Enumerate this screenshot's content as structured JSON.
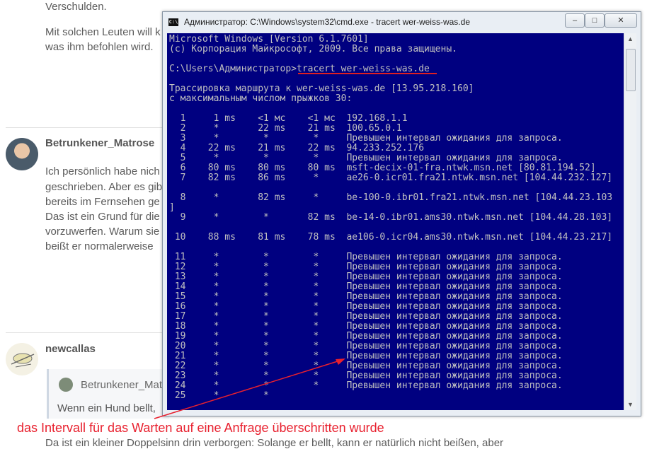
{
  "forum": {
    "p_top": "Verschulden.",
    "p2_line1": "Mit solchen Leuten will k",
    "p2_line2": "was ihm befohlen wird.",
    "user1": "Betrunkener_Matrose",
    "post1": [
      "Ich persönlich habe nich",
      "geschrieben. Aber es gib",
      "bereits im Fernsehen ge",
      "Das ist ein Grund für die",
      "vorzuwerfen. Warum sie",
      "beißt er normalerweise"
    ],
    "user2": "newcallas",
    "quote_user": "Betrunkener_Mat",
    "quote_text": "Wenn ein Hund bellt,",
    "bottom_text": "Da ist ein kleiner Doppelsinn drin verborgen: Solange er bellt, kann er natürlich nicht beißen, aber"
  },
  "window": {
    "title": "Администратор: C:\\Windows\\system32\\cmd.exe - tracert  wer-weiss-was.de",
    "icon_text": "C:\\",
    "btn_minimize": "–",
    "btn_maximize": "□",
    "btn_close": "✕"
  },
  "console": {
    "lines": [
      {
        "text": "Microsoft Windows [Version 6.1.7601]",
        "row": 0
      },
      {
        "text": "(c) Корпорация Майкрософт, 2009. Все права защищены.",
        "row": 1
      },
      {
        "text": "C:\\Users\\Администратор>tracert wer-weiss-was.de",
        "row": 3
      },
      {
        "text": "Трассировка маршрута к wer-weiss-was.de [13.95.218.160]",
        "row": 5
      },
      {
        "text": "с максимальным числом прыжков 30:",
        "row": 6
      },
      {
        "text": "  1     1 ms    <1 мс    <1 мс  192.168.1.1",
        "row": 8
      },
      {
        "text": "  2     *       22 ms    21 ms  100.65.0.1",
        "row": 9
      },
      {
        "text": "  3     *        *        *     Превышен интервал ожидания для запроса.",
        "row": 10
      },
      {
        "text": "  4    22 ms    21 ms    22 ms  94.233.252.176",
        "row": 11
      },
      {
        "text": "  5     *        *        *     Превышен интервал ожидания для запроса.",
        "row": 12
      },
      {
        "text": "  6    80 ms    80 ms    80 ms  msft-decix-01-fra.ntwk.msn.net [80.81.194.52]",
        "row": 13
      },
      {
        "text": "  7    82 ms    86 ms     *     ae26-0.icr01.fra21.ntwk.msn.net [104.44.232.127]",
        "row": 14
      },
      {
        "text": "  8     *       82 ms     *     be-100-0.ibr01.fra21.ntwk.msn.net [104.44.23.103",
        "row": 16
      },
      {
        "text": "]",
        "row": 17
      },
      {
        "text": "  9     *        *       82 ms  be-14-0.ibr01.ams30.ntwk.msn.net [104.44.28.103]",
        "row": 18
      },
      {
        "text": " 10    88 ms    81 ms    78 ms  ae106-0.icr04.ams30.ntwk.msn.net [104.44.23.217]",
        "row": 20
      },
      {
        "text": " 11     *        *        *     Превышен интервал ожидания для запроса.",
        "row": 22
      },
      {
        "text": " 12     *        *        *     Превышен интервал ожидания для запроса.",
        "row": 23
      },
      {
        "text": " 13     *        *        *     Превышен интервал ожидания для запроса.",
        "row": 24
      },
      {
        "text": " 14     *        *        *     Превышен интервал ожидания для запроса.",
        "row": 25
      },
      {
        "text": " 15     *        *        *     Превышен интервал ожидания для запроса.",
        "row": 26
      },
      {
        "text": " 16     *        *        *     Превышен интервал ожидания для запроса.",
        "row": 27
      },
      {
        "text": " 17     *        *        *     Превышен интервал ожидания для запроса.",
        "row": 28
      },
      {
        "text": " 18     *        *        *     Превышен интервал ожидания для запроса.",
        "row": 29
      },
      {
        "text": " 19     *        *        *     Превышен интервал ожидания для запроса.",
        "row": 30
      },
      {
        "text": " 20     *        *        *     Превышен интервал ожидания для запроса.",
        "row": 31
      },
      {
        "text": " 21     *        *        *     Превышен интервал ожидания для запроса.",
        "row": 32
      },
      {
        "text": " 22     *        *        *     Превышен интервал ожидания для запроса.",
        "row": 33
      },
      {
        "text": " 23     *        *        *     Превышен интервал ожидания для запроса.",
        "row": 34
      },
      {
        "text": " 24     *        *        *     Превышен интервал ожидания для запроса.",
        "row": 35
      },
      {
        "text": " 25     *        *",
        "row": 36
      }
    ]
  },
  "annotation": {
    "text": "das Intervall für das Warten auf eine Anfrage überschritten wurde"
  },
  "colors": {
    "console_bg": "#000080",
    "console_text": "#c0c0c0",
    "annotation": "#e8202e"
  }
}
